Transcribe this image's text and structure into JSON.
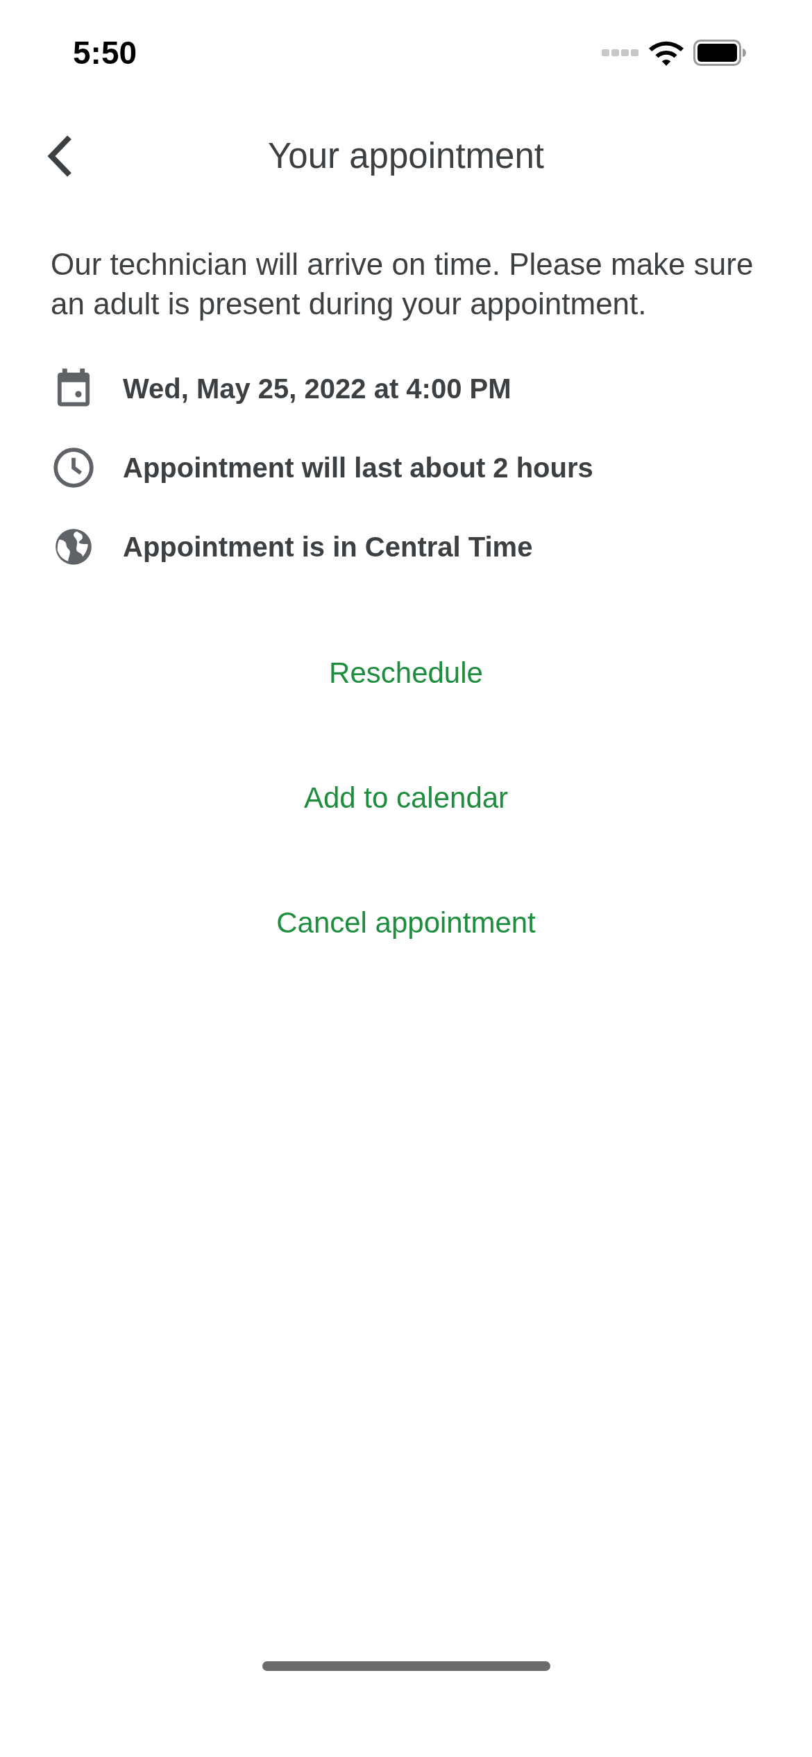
{
  "status_bar": {
    "time": "5:50"
  },
  "header": {
    "title": "Your appointment"
  },
  "notice": "Our technician will arrive on time. Please make sure an adult is present during your appointment.",
  "details": [
    {
      "text": "Wed, May 25, 2022 at 4:00 PM"
    },
    {
      "text": "Appointment will last about 2 hours"
    },
    {
      "text": "Appointment is in Central Time"
    }
  ],
  "actions": [
    "Reschedule",
    "Add to calendar",
    "Cancel appointment"
  ]
}
